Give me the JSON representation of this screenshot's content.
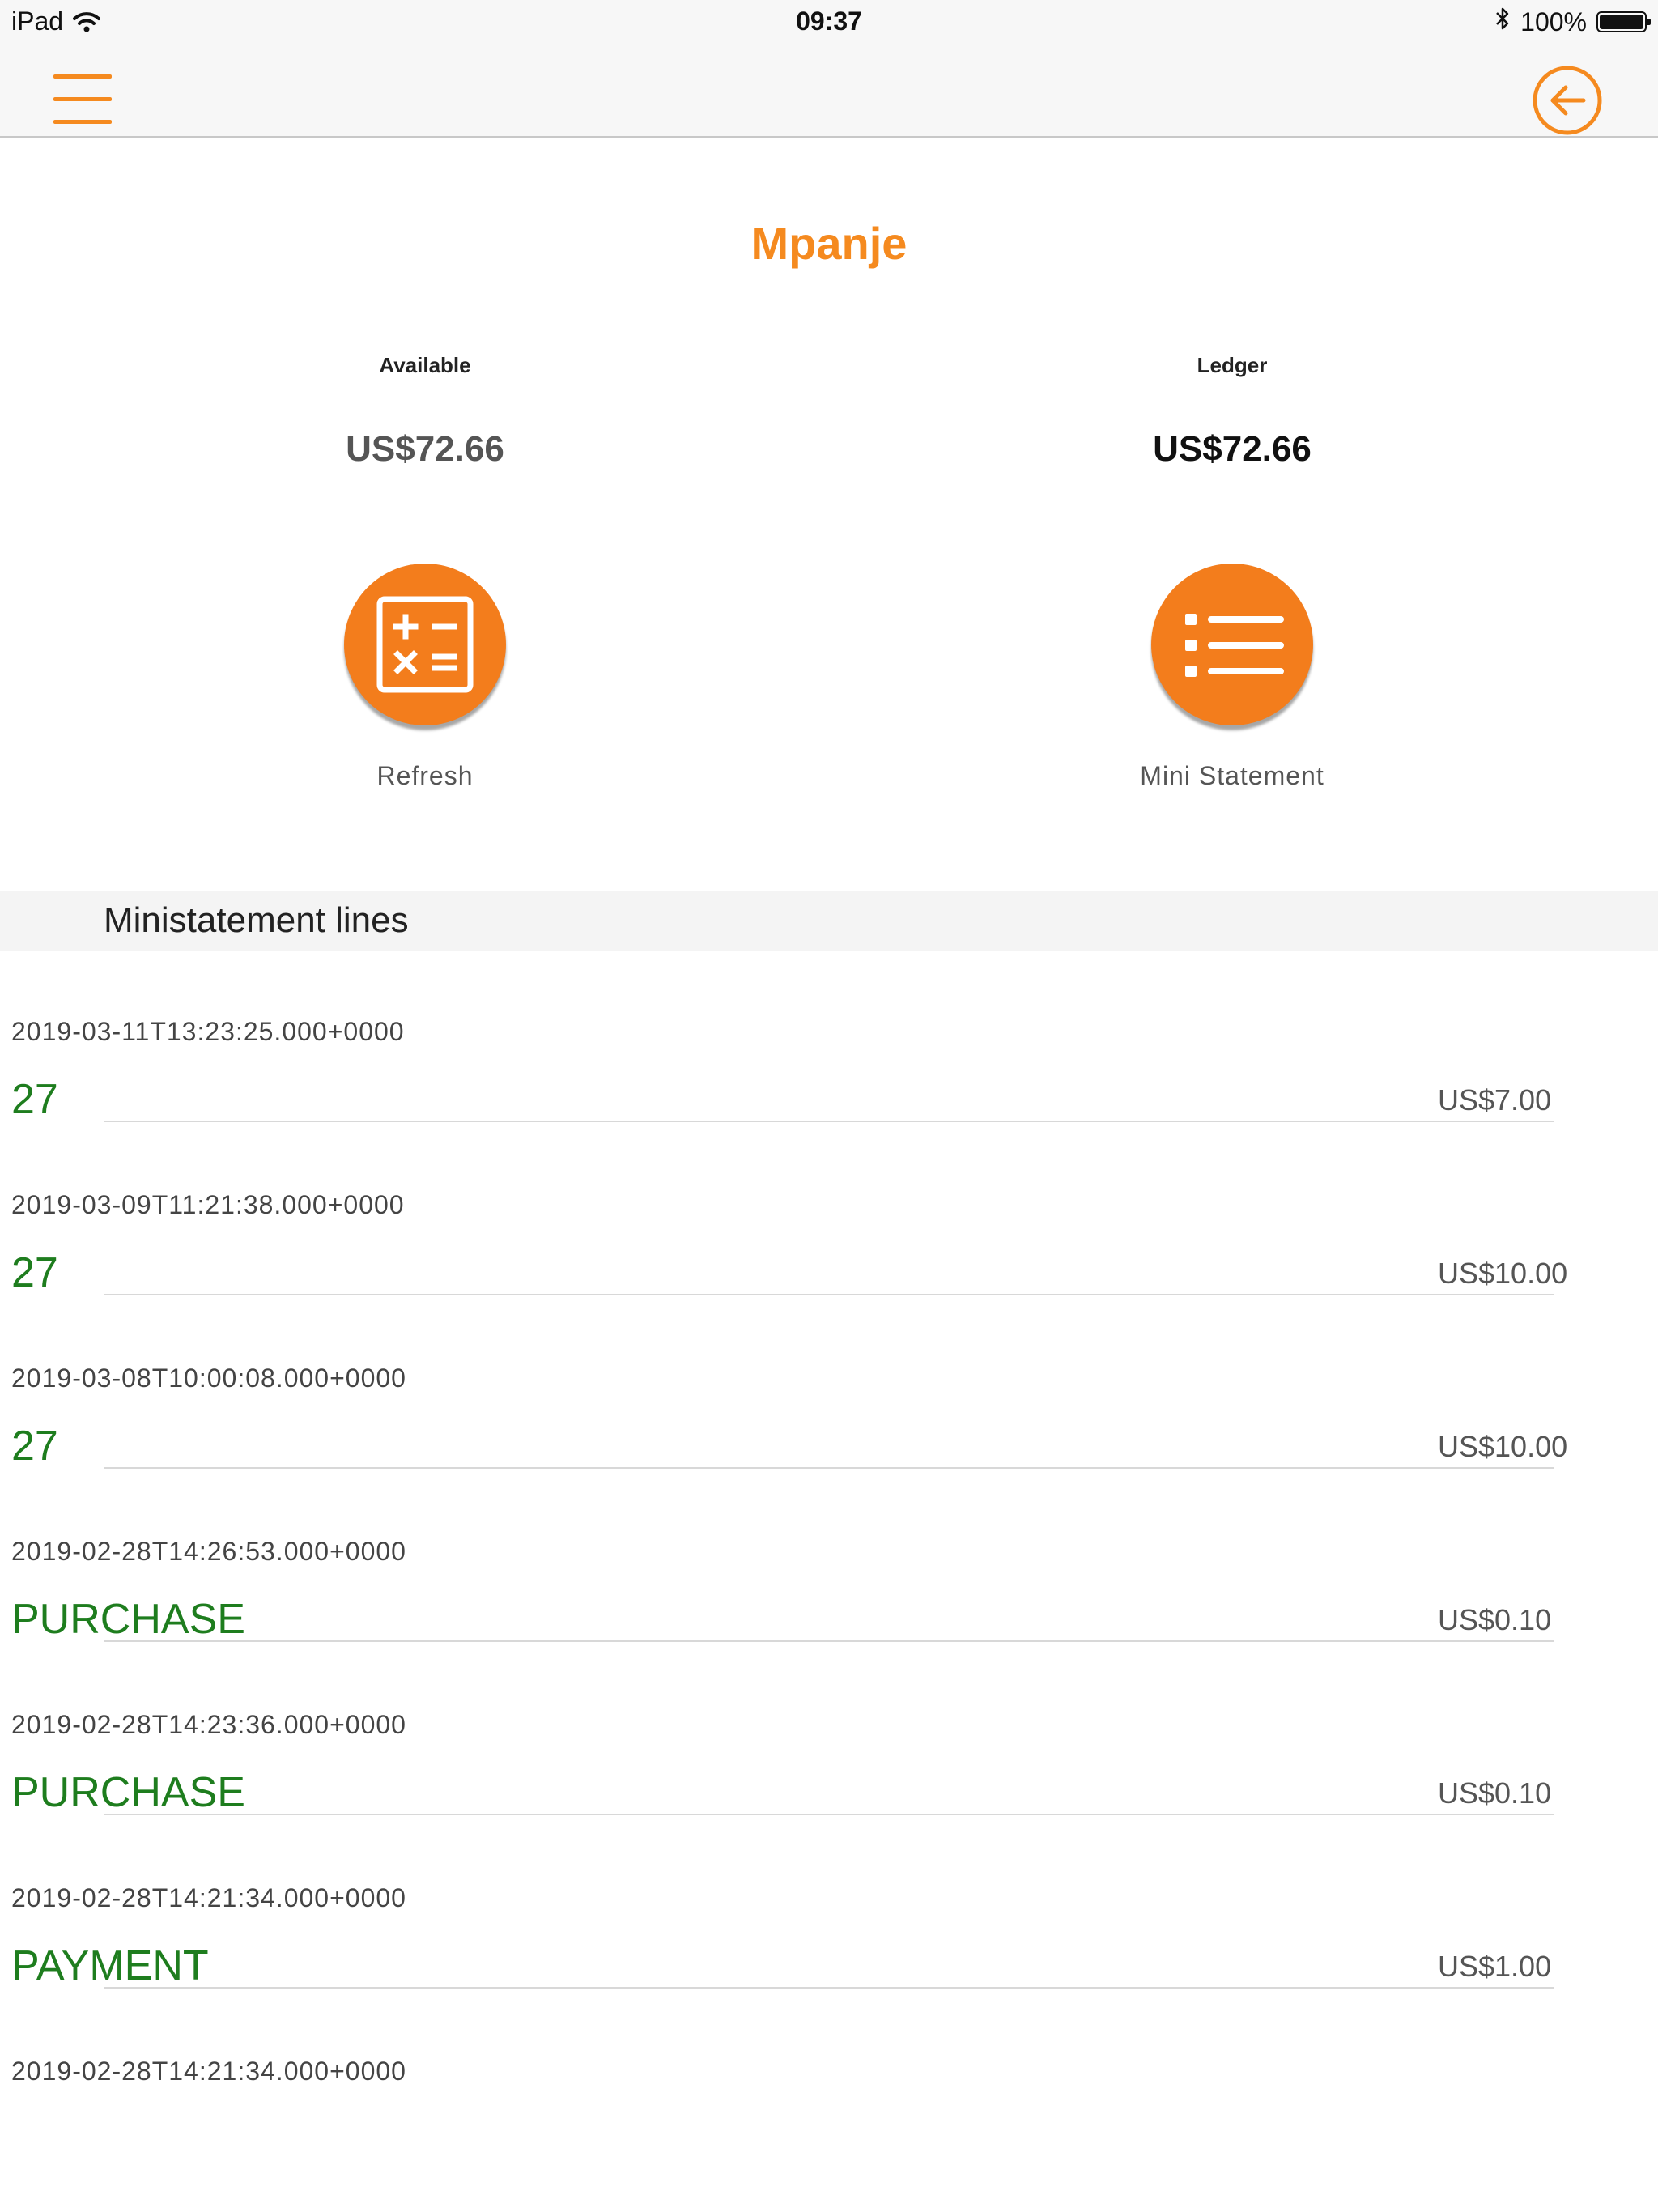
{
  "status_bar": {
    "device": "iPad",
    "time": "09:37",
    "battery": "100%"
  },
  "nav": {
    "menu_icon": "hamburger-menu-icon",
    "back_icon": "back-arrow-icon",
    "accent_color": "#f58a1f"
  },
  "account": {
    "name": "Mpanje",
    "available_label": "Available",
    "available_value": "US$72.66",
    "ledger_label": "Ledger",
    "ledger_value": "US$72.66"
  },
  "actions": {
    "refresh_label": "Refresh",
    "refresh_icon": "calculator-icon",
    "mini_statement_label": "Mini Statement",
    "mini_statement_icon": "list-icon"
  },
  "ministatement": {
    "header": "Ministatement lines",
    "lines": [
      {
        "date": "2019-03-11T13:23:25.000+0000",
        "description": "27",
        "amount": "US$7.00"
      },
      {
        "date": "2019-03-09T11:21:38.000+0000",
        "description": "27",
        "amount": "US$10.00"
      },
      {
        "date": "2019-03-08T10:00:08.000+0000",
        "description": "27",
        "amount": "US$10.00"
      },
      {
        "date": "2019-02-28T14:26:53.000+0000",
        "description": "PURCHASE",
        "amount": "US$0.10"
      },
      {
        "date": "2019-02-28T14:23:36.000+0000",
        "description": "PURCHASE",
        "amount": "US$0.10"
      },
      {
        "date": "2019-02-28T14:21:34.000+0000",
        "description": "PAYMENT",
        "amount": "US$1.00"
      },
      {
        "date": "2019-02-28T14:21:34.000+0000"
      }
    ]
  }
}
